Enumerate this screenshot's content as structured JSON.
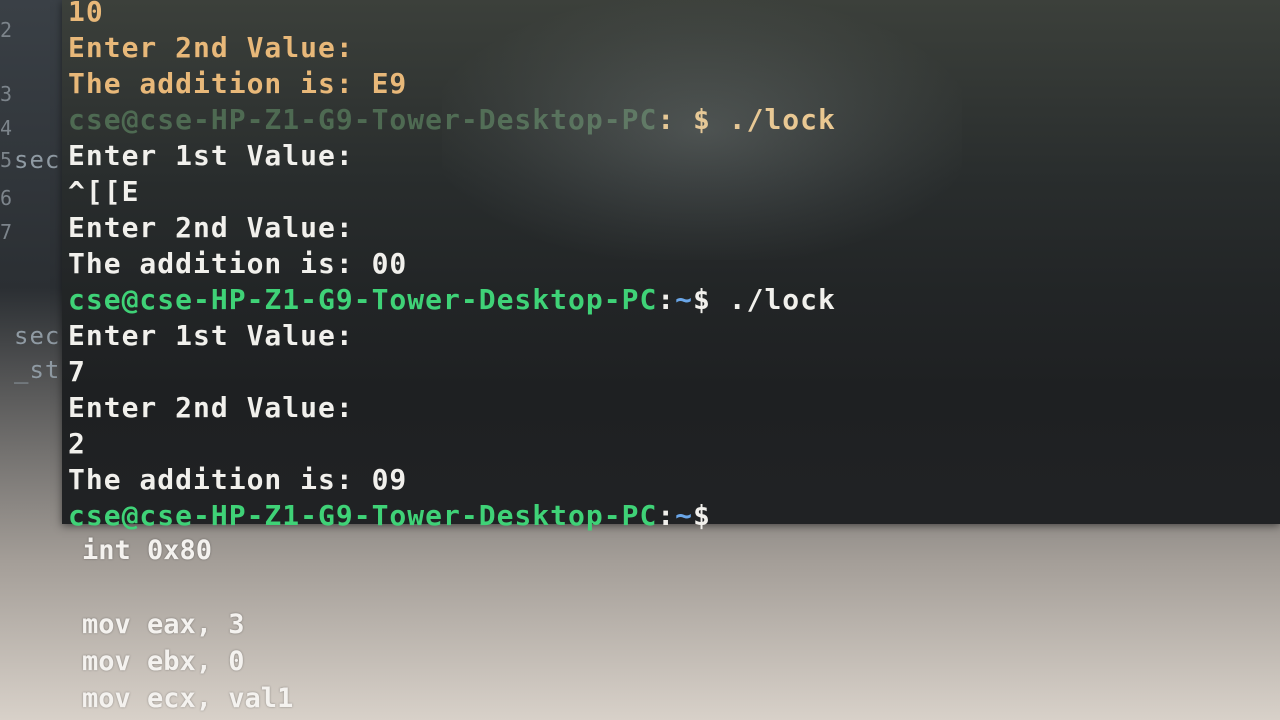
{
  "editor": {
    "gutter": [
      "2",
      "3",
      "4",
      "5",
      "6",
      "7"
    ],
    "side_fragments": [
      "sec",
      "sec",
      "_st"
    ],
    "code_lines": [
      "int 0x80",
      "",
      "mov eax, 3",
      "mov ebx, 0",
      "mov ecx, val1"
    ]
  },
  "terminal": {
    "prompt_user": "cse@cse-HP-Z1-G9-Tower-Desktop-PC",
    "prompt_colon": ":",
    "prompt_path": "~",
    "prompt_symbol": "$",
    "command": "./lock",
    "lines": {
      "l1": "10",
      "l2": "Enter 2nd Value:",
      "l3": "The addition is: E9",
      "l5": "Enter 1st Value:",
      "l6": "^[[E",
      "l7": "Enter 2nd Value:",
      "l8": "The addition is: 00",
      "l10": "Enter 1st Value:",
      "l11": "7",
      "l12": "Enter 2nd Value:",
      "l13": "2",
      "l14": "The addition is: 09"
    }
  },
  "colors": {
    "prompt_user": "#3fd277",
    "prompt_path": "#6aa6e8",
    "output_text": "#f1f0ec",
    "output_text_top": "#e8b879"
  }
}
